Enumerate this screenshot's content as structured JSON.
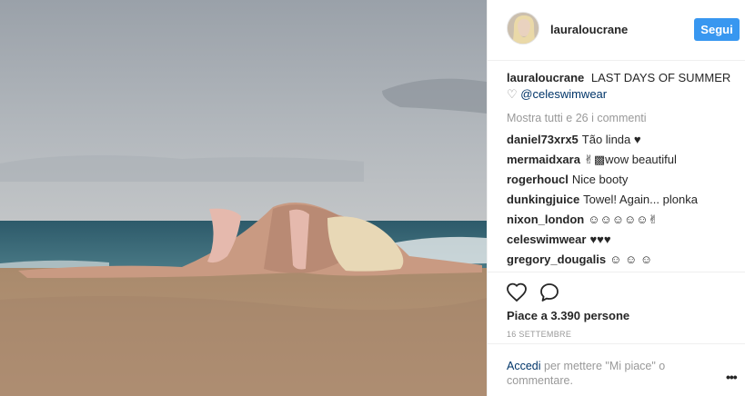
{
  "post": {
    "username": "lauraloucrane",
    "follow_label": "Segui",
    "caption_user": "lauraloucrane",
    "caption_text": "LAST DAYS OF SUMMER",
    "caption_heart": "♡",
    "caption_tag": "@celeswimwear",
    "view_all": "Mostra tutti e 26 i commenti",
    "comments": [
      {
        "user": "daniel73xrx5",
        "text": "Tão linda ♥"
      },
      {
        "user": "mermaidxara",
        "text": "✌︎▩wow beautiful"
      },
      {
        "user": "rogerhoucl",
        "text": "Nice booty"
      },
      {
        "user": "dunkingjuice",
        "text": "Towel! Again... plonka"
      },
      {
        "user": "nixon_london",
        "text": "☺☺☺☺☺✌︎"
      },
      {
        "user": "celeswimwear",
        "text": "♥♥♥"
      },
      {
        "user": "gregory_dougalis",
        "text": "☺ ☺ ☺"
      }
    ],
    "likes": "Piace a 3.390 persone",
    "date": "16 SETTEMBRE",
    "login_link": "Accedi",
    "login_rest": " per mettere \"Mi piace\" o commentare.",
    "more": "•••"
  },
  "icons": {
    "like": "heart-outline-icon",
    "comment": "speech-bubble-icon"
  },
  "colors": {
    "accent": "#3897f0",
    "link": "#003569",
    "muted": "#999999"
  }
}
